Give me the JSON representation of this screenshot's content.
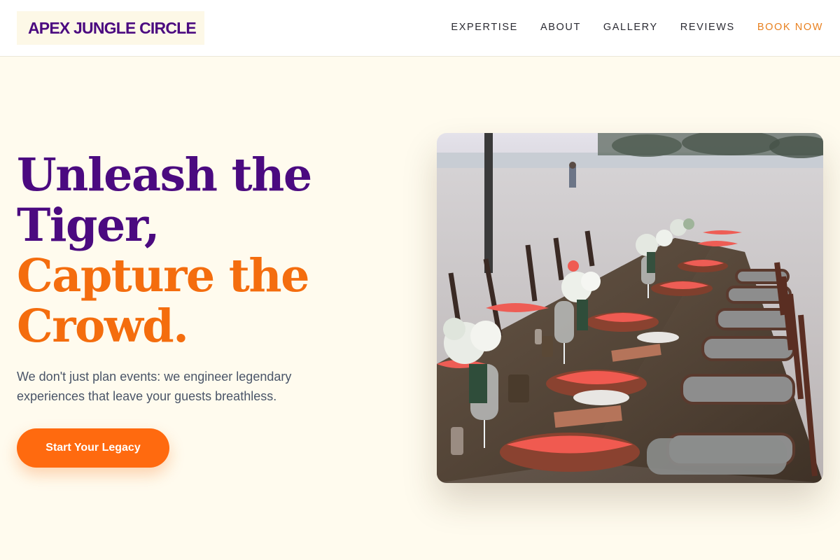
{
  "brand": {
    "name": "APEX JUNGLE CIRCLE"
  },
  "nav": {
    "items": [
      {
        "label": "EXPERTISE"
      },
      {
        "label": "ABOUT"
      },
      {
        "label": "GALLERY"
      },
      {
        "label": "REVIEWS"
      },
      {
        "label": "BOOK NOW"
      }
    ]
  },
  "hero": {
    "title_line1": "Unleash the",
    "title_line2": "Tiger,",
    "title_line3": "Capture the",
    "title_line4": "Crowd.",
    "subtitle": "We don't just plan events: we engineer legendary experiences that leave your guests breathless.",
    "cta_label": "Start Your Legacy"
  },
  "colors": {
    "brand_purple": "#4b0a80",
    "accent_orange": "#f46d0e",
    "background": "#fffbee"
  }
}
